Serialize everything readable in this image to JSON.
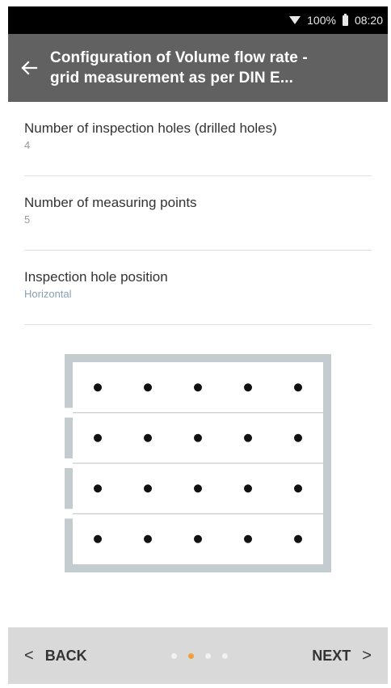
{
  "status_bar": {
    "battery": "100%",
    "time": "08:20"
  },
  "header": {
    "title_line1": "Configuration of Volume flow rate -",
    "title_line2": "grid measurement as per DIN E..."
  },
  "settings": [
    {
      "label": "Number of inspection holes (drilled holes)",
      "value": "4"
    },
    {
      "label": "Number of measuring points",
      "value": "5"
    },
    {
      "label": "Inspection hole position",
      "value": "Horizontal"
    }
  ],
  "diagram": {
    "inspection_holes": 4,
    "measuring_points": 5,
    "hole_position": "Horizontal"
  },
  "nav": {
    "back_label": "BACK",
    "next_label": "NEXT",
    "pages": 4,
    "current_page": 2
  },
  "colors": {
    "header_bg": "#616161",
    "accent": "#f0a03a",
    "diagram_frame": "#c5ccd0"
  }
}
